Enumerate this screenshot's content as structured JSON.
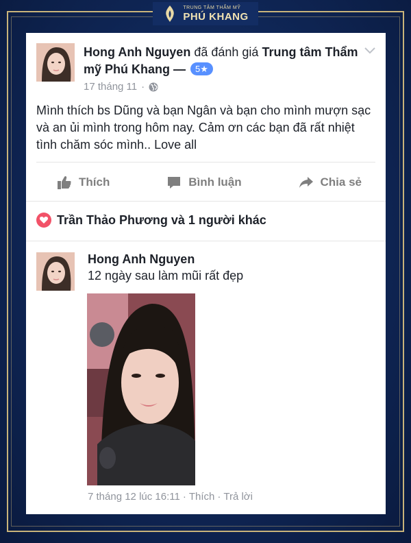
{
  "brand": {
    "subtitle": "TRUNG TÂM THẨM MỸ",
    "name": "PHÚ KHANG"
  },
  "post": {
    "author": "Hong Anh Nguyen",
    "action": "đã đánh giá",
    "target": "Trung tâm Thẩm mỹ Phú Khang",
    "separator": "—",
    "rating": "5★",
    "date": "17 tháng 11",
    "dot": "·",
    "body": "Mình thích bs Dũng và bạn Ngân và bạn cho mình mượn sạc và an ủi mình trong hôm nay. Cảm ơn các bạn đã rất nhiệt tình chăm sóc mình.. Love all"
  },
  "actions": {
    "like": "Thích",
    "comment": "Bình luận",
    "share": "Chia sẻ"
  },
  "reactions": {
    "text": "Trần Thảo Phương và 1 người khác"
  },
  "comment": {
    "author": "Hong Anh Nguyen",
    "text": "12 ngày sau làm mũi rất đẹp",
    "date": "7 tháng 12 lúc 16:11",
    "dot1": "·",
    "like": "Thích",
    "dot2": "·",
    "reply": "Trả lời"
  },
  "icons": {
    "like": "thumbs-up-icon",
    "comment": "speech-bubble-icon",
    "share": "share-arrow-icon",
    "privacy": "globe-icon",
    "reaction": "heart-icon",
    "menu": "chevron-down-icon"
  },
  "colors": {
    "background": "#0f2656",
    "gold": "#c9b47a",
    "badge": "#5890ff",
    "heart": "#f25268",
    "muted": "#90949c"
  }
}
